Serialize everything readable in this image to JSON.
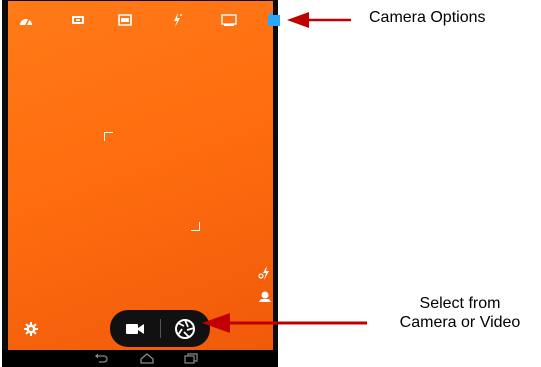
{
  "annotations": {
    "camera_options": "Camera Options",
    "select_line1": "Select from",
    "select_line2": "Camera or Video"
  },
  "top_bar": {
    "icons": [
      "scene-mode-icon",
      "exposure-icon",
      "panorama-icon",
      "flash-mode-icon",
      "hdr-icon",
      "white-balance-icon"
    ]
  },
  "side_controls": {
    "icons": [
      "flash-auto-icon",
      "face-detect-icon",
      "settings-icon"
    ]
  },
  "mode_switch": {
    "options": [
      "video",
      "camera"
    ],
    "selected": "camera"
  },
  "navbar": {
    "buttons": [
      "back",
      "home",
      "recent-apps"
    ]
  },
  "colors": {
    "viewfinder": "#ff7015",
    "arrow": "#c00000",
    "selected_icon": "#2aa6ff"
  }
}
